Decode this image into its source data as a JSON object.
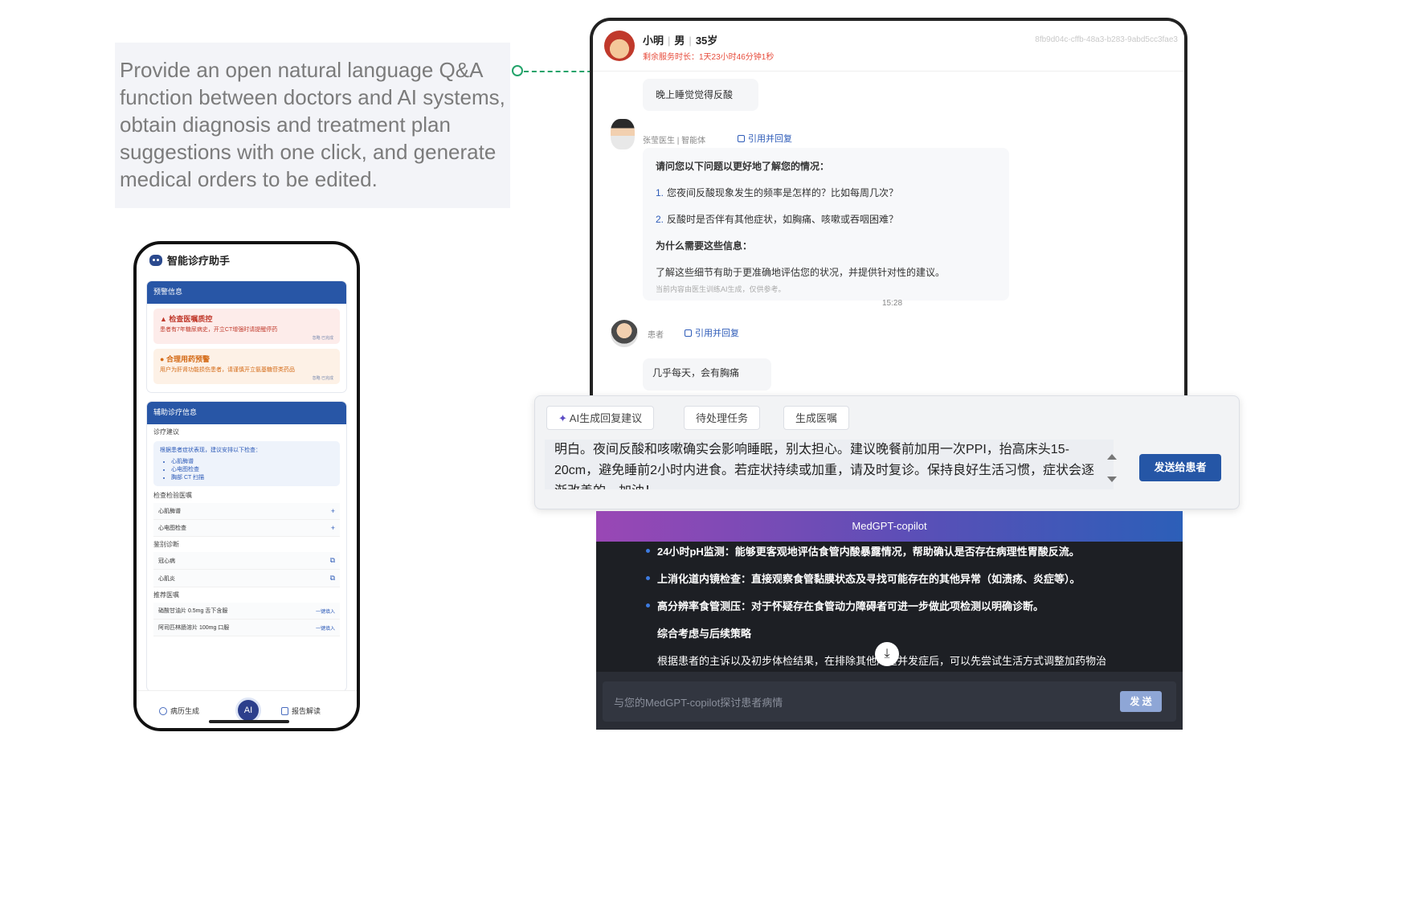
{
  "caption": {
    "text": "Provide an open natural language Q&A function between doctors and AI systems, obtain diagnosis and treatment plan suggestions with one click, and generate medical orders to be edited."
  },
  "phone": {
    "title": "智能诊疗助手",
    "warning": {
      "header": "预警信息",
      "alerts": [
        {
          "title": "检查医嘱质控",
          "desc": "患者有7年糖尿病史，开立CT增强时请提醒停药",
          "links": "忽略  已完成"
        },
        {
          "title": "合理用药预警",
          "desc": "用户为肝肾功能损伤患者，请谨慎开立氨基糖苷类药品",
          "links": "忽略  已完成"
        }
      ]
    },
    "assist": {
      "header": "辅助诊疗信息",
      "suggestion_label": "诊疗建议",
      "suggestion_intro": "根据患者症状表现，建议安排以下检查：",
      "suggestion_items": [
        "心肌酶谱",
        "心电图检查",
        "胸部 CT 扫描"
      ],
      "exam_label": "检查检验医嘱",
      "exams": [
        "心肌酶谱",
        "心电图检查"
      ],
      "diff_label": "鉴别诊断",
      "diffs": [
        "冠心病",
        "心肌炎"
      ],
      "rec_label": "推荐医嘱",
      "recs": [
        {
          "name": "硝酸甘油片 0.5mg 舌下含服",
          "action": "一键填入"
        },
        {
          "name": "阿司匹林肠溶片 100mg 口服",
          "action": "一键填入"
        }
      ]
    },
    "bottom": {
      "left": "病历生成",
      "center": "AI",
      "right": "报告解读"
    }
  },
  "tablet": {
    "patient_name": "小明",
    "patient_gender": "男",
    "patient_age": "35岁",
    "remaining": "剩余服务时长：1天23小时46分钟1秒",
    "session_id": "8fb9d04c-cffb-48a3-b283-9abd5cc3fae3",
    "patient_msg": "晚上睡觉觉得反酸",
    "doctor_meta": "张莹医生 | 智能体",
    "quote_label": "引用并回复",
    "ai_heading": "请问您以下问题以更好地了解您的情况：",
    "q1_num": "1.",
    "q1": "您夜间反酸现象发生的频率是怎样的？比如每周几次？",
    "q2_num": "2.",
    "q2": "反酸时是否伴有其他症状，如胸痛、咳嗽或吞咽困难？",
    "why_heading": "为什么需要这些信息：",
    "why_text": "了解这些细节有助于更准确地评估您的状况，并提供针对性的建议。",
    "ai_note": "当前内容由医生训练AI生成，仅供参考。",
    "time": "15:28",
    "patient_meta": "患者",
    "patient_msg2": "几乎每天，会有胸痛"
  },
  "reply": {
    "btn_ai": "AI生成回复建议",
    "btn_todo": "待处理任务",
    "btn_order": "生成医嘱",
    "text": "明白。夜间反酸和咳嗽确实会影响睡眠，别太担心。建议晚餐前加用一次PPI，抬高床头15-20cm，避免睡前2小时内进食。若症状持续或加重，请及时复诊。保持良好生活习惯，症状会逐渐改善的，加油！",
    "send": "发送给患者"
  },
  "copilot": {
    "title": "MedGPT-copilot",
    "items": [
      "24小时pH监测：能够更客观地评估食管内酸暴露情况，帮助确认是否存在病理性胃酸反流。",
      "上消化道内镜检查：直接观察食管黏膜状态及寻找可能存在的其他异常（如溃疡、炎症等）。",
      "高分辨率食管测压：对于怀疑存在食管动力障碍者可进一步做此项检测以明确诊断。"
    ],
    "strategy_heading": "综合考虑与后续策略",
    "strategy_text": "根据患者的主诉以及初步体检结果，在排除其他严重并发症后，可以先尝试生活方式调整加药物治",
    "placeholder": "与您的MedGPT-copilot探讨患者病情",
    "send": "发 送"
  }
}
